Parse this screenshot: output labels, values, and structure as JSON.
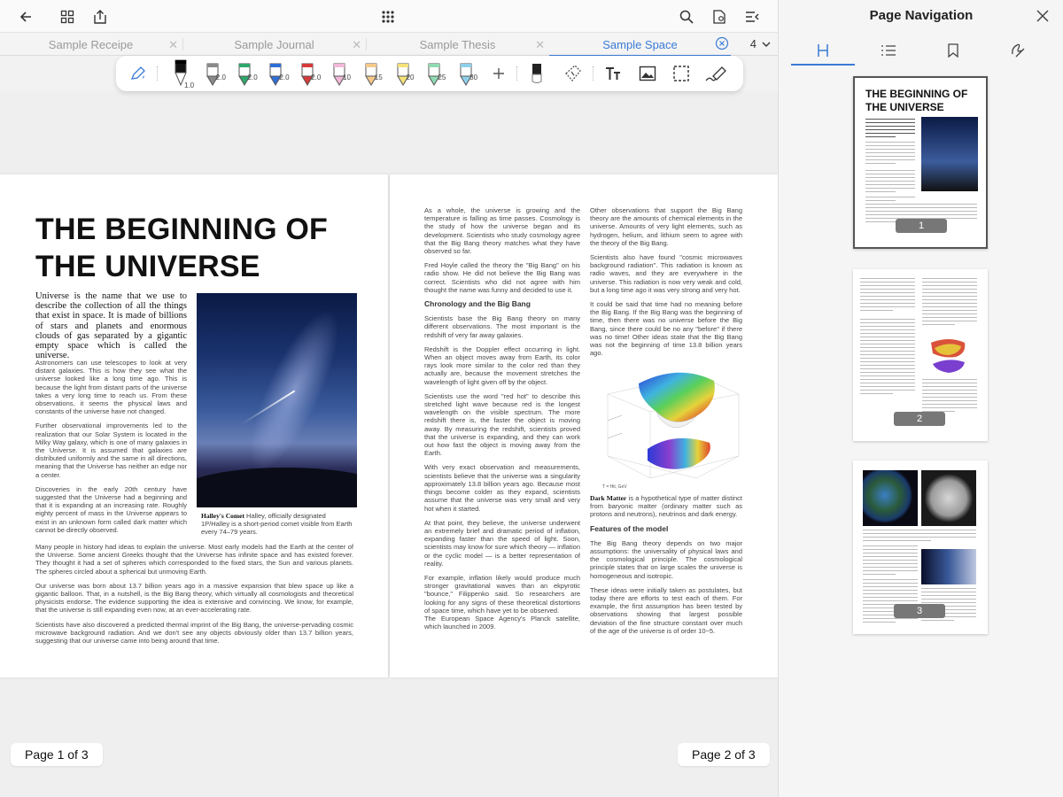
{
  "tabs": {
    "items": [
      {
        "label": "Sample Receipe"
      },
      {
        "label": "Sample Journal"
      },
      {
        "label": "Sample Thesis"
      },
      {
        "label": "Sample Space"
      }
    ],
    "count": "4"
  },
  "toolbar": {
    "pens": [
      {
        "size": "1.0",
        "color": "#000000"
      },
      {
        "size": "2.0",
        "color": "#8a8a8a"
      },
      {
        "size": "2.0",
        "color": "#2fa86b"
      },
      {
        "size": "2.0",
        "color": "#2f6fd6"
      },
      {
        "size": "2.0",
        "color": "#d63a3a"
      },
      {
        "size": "10",
        "color": "#f2b8d9"
      },
      {
        "size": "15",
        "color": "#f6c98a"
      },
      {
        "size": "20",
        "color": "#f5e27a"
      },
      {
        "size": "25",
        "color": "#8fdcb2"
      },
      {
        "size": "30",
        "color": "#8ed0ec"
      }
    ]
  },
  "document": {
    "page_left": {
      "title": "THE BEGINNING OF THE UNIVERSE",
      "lead": "Universe is the name that we use to describe the collection of all the things that exist in space. It is made of billions of stars and planets and enormous clouds of gas separated by a gigantic empty space which is called the universe.",
      "col_paragraphs": [
        "Astronomers can use telescopes to look at very distant galaxies. This is how they see what the universe looked like a long time ago. This is because the light from distant parts of the universe takes a very long time to reach us. From these observations, it seems the physical laws and constants of the universe have not changed.",
        "Further observational improvements led to the realization that our Solar System is located in the Milky Way galaxy, which is one of many galaxies in the Universe. It is assumed that galaxies are distributed uniformly and the same in all directions, meaning that the Universe has neither an edge nor a center.",
        "Discoveries in the early 20th century have suggested that the Universe had a beginning and that it is expanding at an increasing rate. Roughly eighty percent of mass in the Universe appears to exist in an unknown form called dark matter which cannot be directly observed."
      ],
      "caption_bold": "Halley's Comet",
      "caption_text": " Halley, officially designated 1P/Halley is a short-period comet visible from Earth every 74–79 years.",
      "full_paragraphs": [
        "Many people in history had ideas to explain the universe. Most early models had the Earth at the center of the Universe. Some ancient Greeks thought that the Universe has infinite space and has existed forever. They thought it had a set of spheres which corresponded to the fixed stars, the Sun and various planets. The spheres circled about a spherical but unmoving Earth.",
        "Our universe was born about 13.7 billion years ago in a massive expansion that blew space up like a gigantic balloon. That, in a nutshell, is the Big Bang theory, which virtually all cosmologists and theoretical physicists endorse. The evidence supporting the idea is extensive and convincing. We know, for example, that the universe is still expanding even now, at an ever-accelerating rate.",
        "Scientists have also discovered a predicted thermal imprint of the Big Bang, the universe-pervading cosmic microwave background radiation. And we don't see any objects obviously older than 13.7 billion years, suggesting that our universe came into being around that time."
      ],
      "page_label": "Page 1 of 3"
    },
    "page_right": {
      "col1_intro": [
        "As a whole, the universe is growing and the temperature is falling as time passes. Cosmology is the study of how the universe began and its development. Scientists who study cosmology agree that the Big Bang theory matches what they have observed so far.",
        "Fred Hoyle called the theory the \"Big Bang\" on his radio show. He did not believe the Big Bang was correct. Scientists who did not agree with him thought the name was funny and decided to use it."
      ],
      "heading1": "Chronology and the Big Bang",
      "col1_rest": [
        "Scientists base the Big Bang theory on many different observations. The most important is the redshift of very far away galaxies.",
        "Redshift is the Doppler effect occurring in light. When an object moves away from Earth, its color rays look more similar to the color red than they actually are, because the movement stretches the wavelength of light given off by the object.",
        "Scientists use the word \"red hot\" to describe this stretched light wave because red is the longest wavelength on the visible spectrum. The more redshift there is, the faster the object is moving away. By measuring the redshift, scientists proved that the universe is expanding, and they can work out how fast the object is moving away from the Earth.",
        "With very exact observation and measurements, scientists believe that the universe was a singularity approximately 13.8 billion years ago. Because most things become colder as they expand, scientists assume that the universe was very small and very hot when it started.",
        "At that point, they believe, the universe underwent an extremely brief and dramatic period of inflation, expanding faster than the speed of light. Soon, scientists may know for sure which theory — inflation or the cyclic model — is a better representation of reality.",
        "For example, inflation likely would produce much stronger gravitational waves than an ekpyrotic \"bounce,\" Filippenko said. So researchers are looking for any signs of these theoretical distortions of space time, which have yet to be observed.\nThe European Space Agency's Planck satellite, which launched in 2009."
      ],
      "col2_paragraphs": [
        "Other observations that support the Big Bang theory are the amounts of chemical elements in the universe. Amounts of very light elements, such as hydrogen, helium, and lithium seem to agree with the theory of the Big Bang.",
        "Scientists also have found \"cosmic microwaves background radiation\". This radiation is known as radio waves, and they are everywhere in the universe. This radiation is now very weak and cold, but a long time ago it was very strong and very hot.",
        "It could be said that time had no meaning before the Big Bang. If the Big Bang was the beginning of time, then there was no universe before the Big Bang, since there could be no any \"before\" if there was no time! Other ideas state that the Big Bang was not the beginning of time 13.8 billion years ago."
      ],
      "plot_label": "T = Hit,  GeV",
      "dark_matter_bold": "Dark Matter",
      "dark_matter_text": " is a hypothetical type of matter distinct from baryonic matter (ordinary matter such as protons and neutrons), neutrinos and dark energy.",
      "heading2": "Features of the model",
      "col2_rest": [
        "The Big Bang theory depends on two major assumptions: the universality of physical laws and the cosmological principle. The cosmological principle states that on large scales the universe is homogeneous and isotropic.",
        "These ideas were initially taken as postulates, but today there are efforts to test each of them. For example, the first assumption has been tested by observations showing that largest possible deviation of the fine structure constant over much of the age of the universe is of order 10−5."
      ],
      "page_label": "Page 2 of 3"
    }
  },
  "side_panel": {
    "title": "Page Navigation",
    "tab_icons": [
      "outline-icon",
      "list-icon",
      "bookmark-icon",
      "annotation-icon"
    ],
    "thumbnails": [
      {
        "number": "1",
        "title": "THE BEGINNING OF THE UNIVERSE"
      },
      {
        "number": "2"
      },
      {
        "number": "3"
      }
    ]
  },
  "colors": {
    "accent": "#3a7bd5"
  }
}
